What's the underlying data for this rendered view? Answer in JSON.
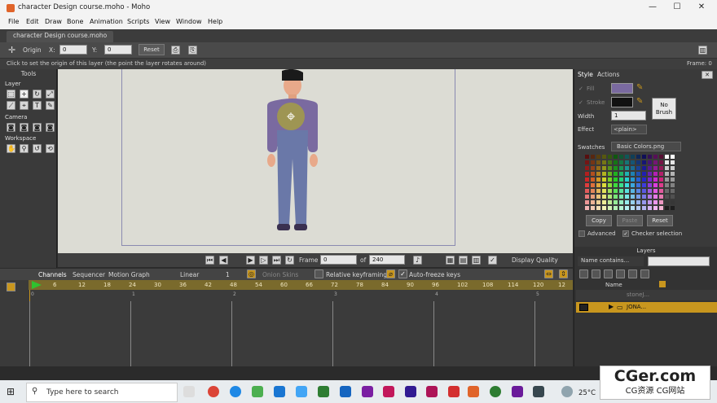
{
  "window": {
    "title": "character Design course.moho - Moho",
    "min": "—",
    "max": "☐",
    "close": "✕"
  },
  "menu": [
    "File",
    "Edit",
    "Draw",
    "Bone",
    "Animation",
    "Scripts",
    "View",
    "Window",
    "Help"
  ],
  "doc_tab": "character Design course.moho",
  "tool_options": {
    "origin_label": "Origin",
    "x_label": "X:",
    "x_value": "0",
    "y_label": "Y:",
    "y_value": "0",
    "reset": "Reset"
  },
  "status": {
    "hint": "Click to set the origin of this layer (the point the layer rotates around)",
    "frame": "Frame: 0"
  },
  "tools": {
    "title": "Tools",
    "sections": [
      "Layer",
      "Camera",
      "Workspace"
    ]
  },
  "playback": {
    "frame_label": "Frame",
    "frame_value": "0",
    "of_label": "of",
    "of_value": "240",
    "display_quality": "Display Quality"
  },
  "timeline": {
    "tabs": [
      "Channels",
      "Sequencer",
      "Motion Graph"
    ],
    "interp": "Linear",
    "step": "1",
    "onion": "Onion Skins",
    "relative": "Relative keyframing",
    "autofreeze": "Auto-freeze keys",
    "ruler": [
      "6",
      "12",
      "18",
      "24",
      "30",
      "36",
      "42",
      "48",
      "54",
      "60",
      "66",
      "72",
      "78",
      "84",
      "90",
      "96",
      "102",
      "108",
      "114",
      "120",
      "12"
    ],
    "markers": [
      "0",
      "1",
      "2",
      "3",
      "4",
      "5"
    ]
  },
  "style_panel": {
    "tabs": [
      "Style",
      "Actions"
    ],
    "fill": "Fill",
    "stroke": "Stroke",
    "width_label": "Width",
    "width_value": "1",
    "no_brush": "No\nBrush",
    "effect_label": "Effect",
    "effect_value": "<plain>",
    "swatches_label": "Swatches",
    "swatches_file": "Basic Colors.png",
    "copy": "Copy",
    "paste": "Paste",
    "reset": "Reset",
    "advanced": "Advanced",
    "checker": "Checker selection",
    "fill_color": "#7a6aa0",
    "stroke_color": "#111111"
  },
  "layers_panel": {
    "title": "Layers",
    "filter": "Name contains...",
    "col_name": "Name",
    "rows": [
      "stoneJ...",
      "JONA..."
    ]
  },
  "taskbar": {
    "search": "Type here to search",
    "temp": "25°C"
  },
  "watermark": {
    "main": "CGer.com",
    "sub": "CG资源 CG网站"
  },
  "colors": {
    "accent": "#c8961e",
    "ruler": "#7a6a2c",
    "selected_layer": "#c8961e"
  }
}
